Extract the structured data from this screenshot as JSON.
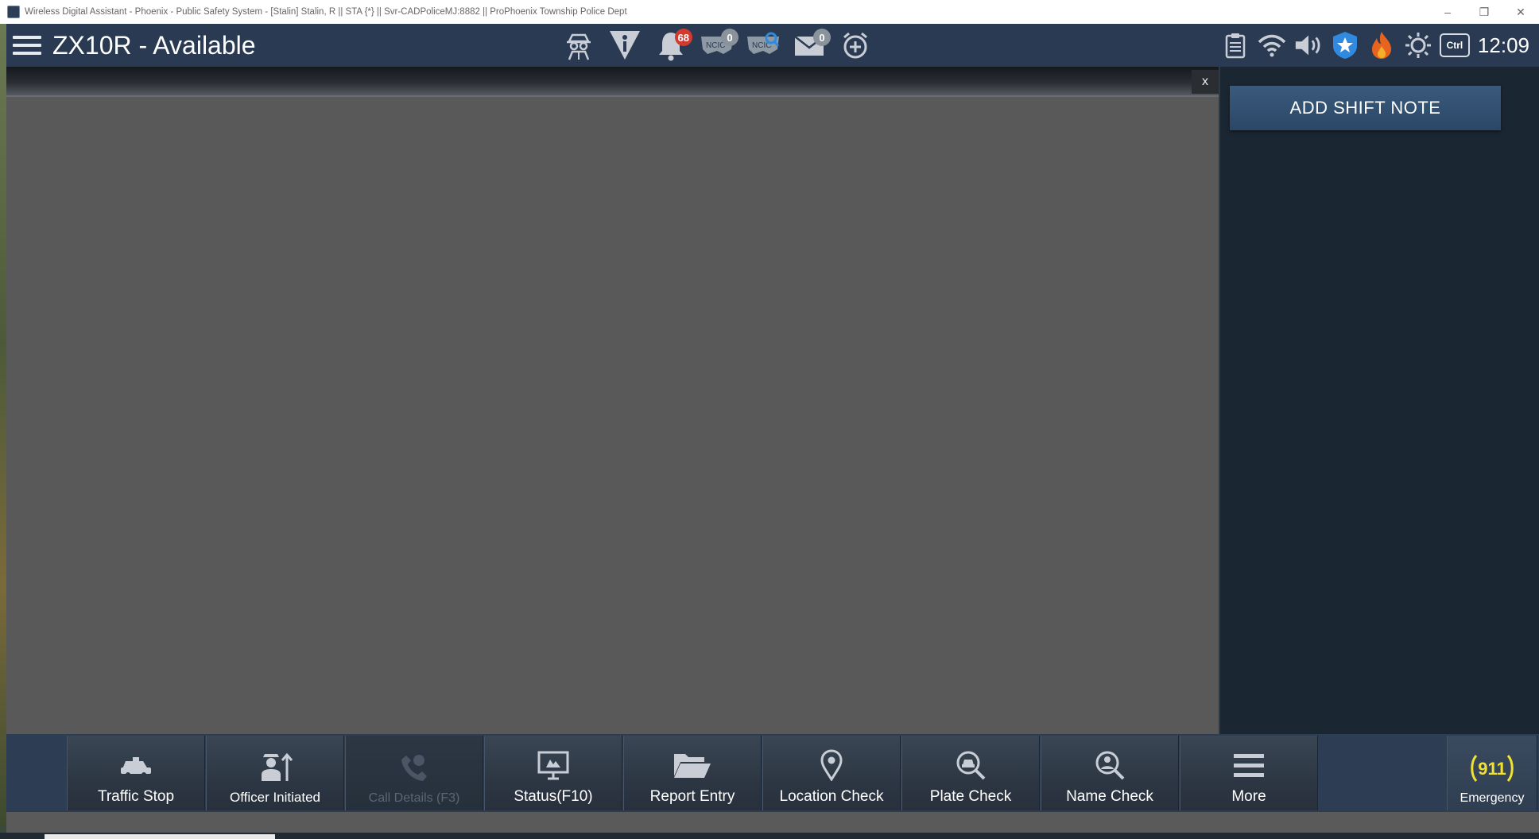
{
  "window": {
    "title": "Wireless Digital Assistant - Phoenix - Public Safety System - [Stalin] Stalin, R || STA {*} || Svr-CADPoliceMJ:8882 || ProPhoenix Township Police Dept",
    "minimize": "–",
    "restore": "❐",
    "close": "✕"
  },
  "header": {
    "unit_status": "ZX10R - Available",
    "alerts_count": "68",
    "ncic_count": "0",
    "messages_count": "0",
    "ncic_label": "NCIC",
    "ctrl_label": "Ctrl",
    "clock": "12:09",
    "icons": [
      "spy-icon",
      "info-warning-icon",
      "bell-icon",
      "ncic-icon",
      "ncic-search-icon",
      "mail-icon",
      "alarm-add-icon",
      "clipboard-icon",
      "wifi-icon",
      "speaker-icon",
      "police-badge-icon",
      "fire-icon",
      "brightness-icon"
    ]
  },
  "main": {
    "close_label": "x"
  },
  "side": {
    "add_shift_note": "ADD SHIFT NOTE"
  },
  "toolbar": {
    "buttons": [
      {
        "label": "Traffic Stop",
        "icon": "car-icon",
        "enabled": true
      },
      {
        "label": "Officer Initiated",
        "icon": "officer-icon",
        "enabled": true
      },
      {
        "label": "Call Details (F3)",
        "icon": "phone-icon",
        "enabled": false
      },
      {
        "label": "Status(F10)",
        "icon": "monitor-icon",
        "enabled": true
      },
      {
        "label": "Report Entry",
        "icon": "folder-icon",
        "enabled": true
      },
      {
        "label": "Location Check",
        "icon": "location-pin-icon",
        "enabled": true
      },
      {
        "label": "Plate Check",
        "icon": "car-search-icon",
        "enabled": true
      },
      {
        "label": "Name Check",
        "icon": "person-search-icon",
        "enabled": true
      },
      {
        "label": "More",
        "icon": "menu-icon",
        "enabled": true
      }
    ],
    "emergency": {
      "label": "Emergency",
      "icon_text": "911"
    }
  },
  "colors": {
    "header_bg": "#2a3a52",
    "main_bg": "#595959",
    "side_bg": "#1b2633",
    "badge_red": "#d23a2f",
    "emergency_yellow": "#f2e230"
  }
}
